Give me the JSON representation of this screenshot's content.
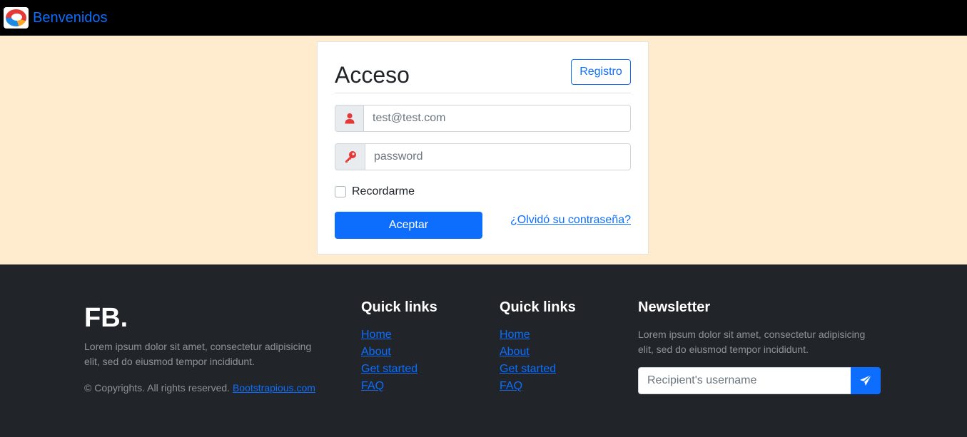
{
  "navbar": {
    "brand_text": "Benvenidos",
    "logo_icon": "colorful-ring-logo"
  },
  "login": {
    "title": "Acceso",
    "register_label": "Registro",
    "email_placeholder": "test@test.com",
    "password_placeholder": "password",
    "remember_label": "Recordarme",
    "submit_label": "Aceptar",
    "forgot_label": "¿Olvidó su contraseña?",
    "user_icon": "user-icon",
    "key_icon": "key-icon"
  },
  "footer": {
    "brand": "FB.",
    "description": "Lorem ipsum dolor sit amet, consectetur adipisicing elit, sed do eiusmod tempor incididunt.",
    "copyright_text": "© Copyrights. All rights reserved. ",
    "copyright_link": "Bootstrapious.com",
    "link_columns": [
      {
        "title": "Quick links",
        "links": [
          "Home",
          "About",
          "Get started",
          "FAQ"
        ]
      },
      {
        "title": "Quick links",
        "links": [
          "Home",
          "About",
          "Get started",
          "FAQ"
        ]
      }
    ],
    "newsletter": {
      "title": "Newsletter",
      "description": "Lorem ipsum dolor sit amet, consectetur adipisicing elit, sed do eiusmod tempor incididunt.",
      "placeholder": "Recipient's username",
      "send_icon": "paper-plane-icon"
    }
  },
  "colors": {
    "page_bg": "#ffebcd",
    "primary": "#0d6efd",
    "footer_bg": "#212529",
    "icon_red": "#e53935"
  }
}
